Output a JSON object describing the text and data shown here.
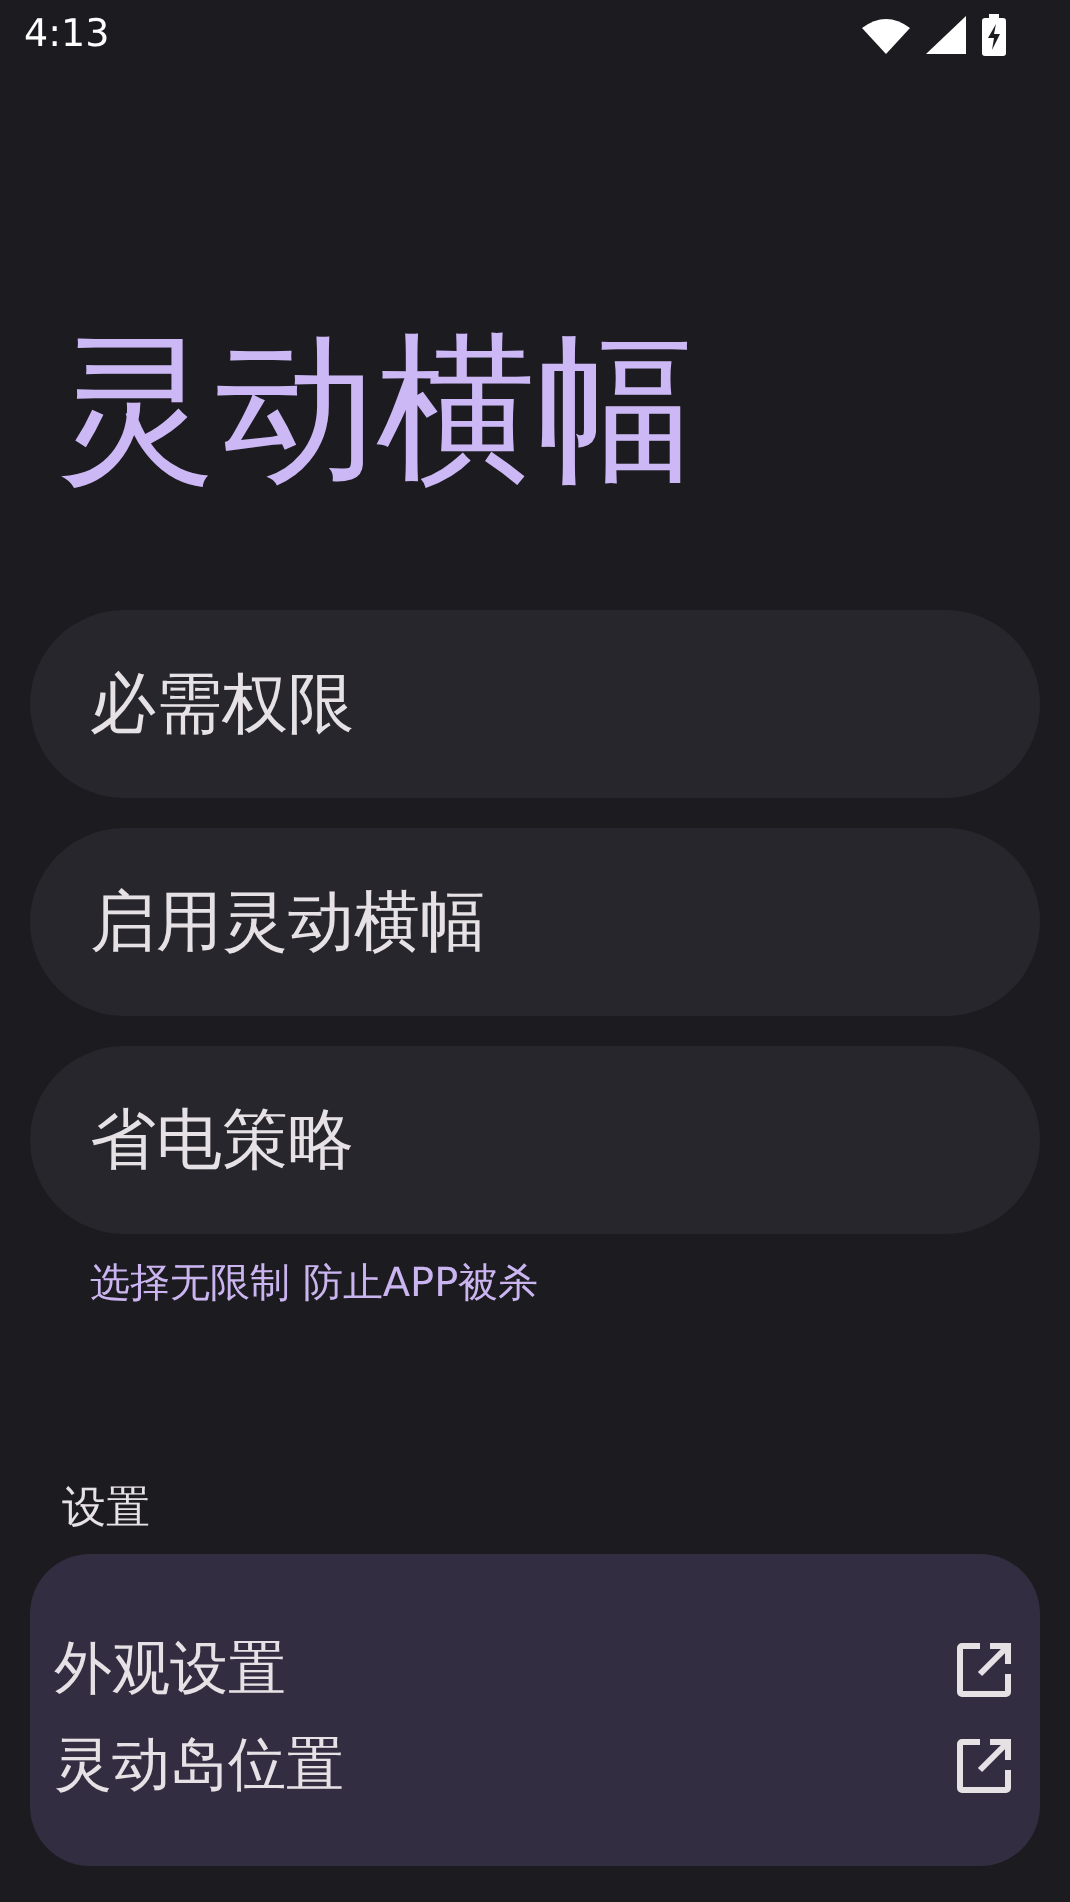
{
  "status_bar": {
    "time": "4:13"
  },
  "title": "灵动横幅",
  "cards": [
    {
      "label": "必需权限"
    },
    {
      "label": "启用灵动横幅"
    },
    {
      "label": "省电策略",
      "hint": "选择无限制 防止APP被杀"
    }
  ],
  "settings": {
    "heading": "设置",
    "items": [
      {
        "label": "外观设置"
      },
      {
        "label": "灵动岛位置"
      }
    ]
  }
}
